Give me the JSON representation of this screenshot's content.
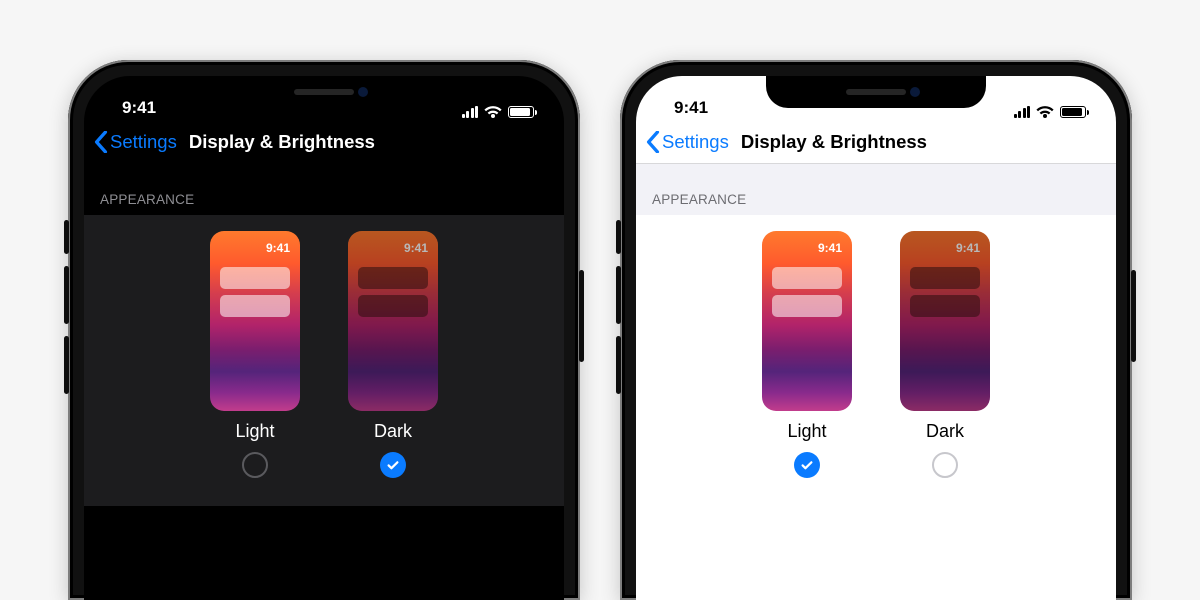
{
  "status": {
    "time": "9:41"
  },
  "nav": {
    "back": "Settings",
    "title": "Display & Brightness"
  },
  "section": {
    "appearance": "APPEARANCE"
  },
  "options": {
    "light": {
      "label": "Light",
      "preview_time": "9:41"
    },
    "dark": {
      "label": "Dark",
      "preview_time": "9:41"
    }
  },
  "phones": {
    "left": {
      "theme": "dark",
      "selected": "dark"
    },
    "right": {
      "theme": "light",
      "selected": "light"
    }
  },
  "colors": {
    "accent": "#0a7bff"
  }
}
